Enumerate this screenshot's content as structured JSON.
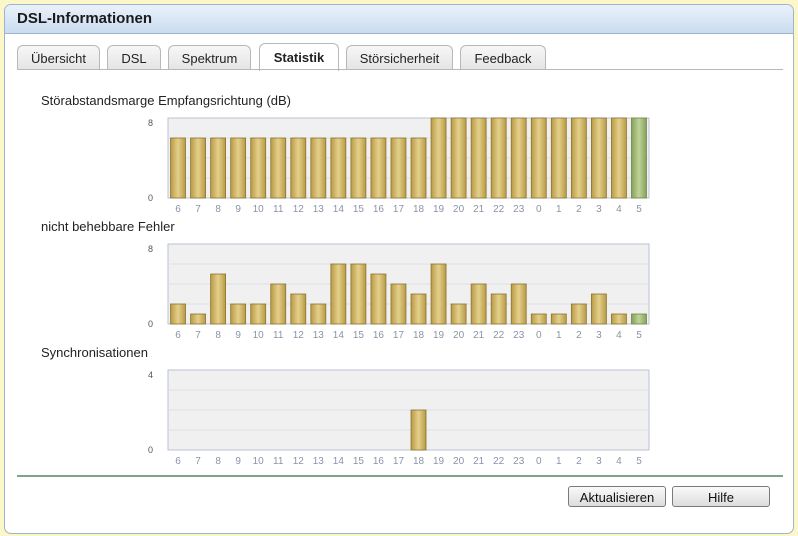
{
  "window": {
    "title": "DSL-Informationen"
  },
  "tabs": [
    {
      "label": "Übersicht",
      "active": false
    },
    {
      "label": "DSL",
      "active": false
    },
    {
      "label": "Spektrum",
      "active": false
    },
    {
      "label": "Statistik",
      "active": true
    },
    {
      "label": "Störsicherheit",
      "active": false
    },
    {
      "label": "Feedback",
      "active": false
    }
  ],
  "charts": {
    "snr": {
      "label": "Störabstandsmarge Empfangsrichtung (dB)"
    },
    "errors": {
      "label": "nicht behebbare Fehler"
    },
    "sync": {
      "label": "Synchronisationen"
    }
  },
  "buttons": {
    "refresh_label": "Aktualisieren",
    "help_label": "Hilfe"
  },
  "colors": {
    "bar": "#c9b15f",
    "bar_current": "#9fb570",
    "separator": "#7fa38a"
  },
  "chart_data": [
    {
      "type": "bar",
      "title": "Störabstandsmarge Empfangsrichtung (dB)",
      "categories": [
        "6",
        "7",
        "8",
        "9",
        "10",
        "11",
        "12",
        "13",
        "14",
        "15",
        "16",
        "17",
        "18",
        "19",
        "20",
        "21",
        "22",
        "23",
        "0",
        "1",
        "2",
        "3",
        "4",
        "5"
      ],
      "values": [
        6,
        6,
        6,
        6,
        6,
        6,
        6,
        6,
        6,
        6,
        6,
        6,
        6,
        8,
        8,
        8,
        8,
        8,
        8,
        8,
        8,
        8,
        8,
        8
      ],
      "ylim": [
        0,
        8
      ],
      "yticks": [
        "0",
        "8"
      ],
      "grid": true
    },
    {
      "type": "bar",
      "title": "nicht behebbare Fehler",
      "categories": [
        "6",
        "7",
        "8",
        "9",
        "10",
        "11",
        "12",
        "13",
        "14",
        "15",
        "16",
        "17",
        "18",
        "19",
        "20",
        "21",
        "22",
        "23",
        "0",
        "1",
        "2",
        "3",
        "4",
        "5"
      ],
      "values": [
        2,
        1,
        5,
        2,
        2,
        4,
        3,
        2,
        6,
        6,
        5,
        4,
        3,
        6,
        2,
        4,
        3,
        4,
        1,
        1,
        2,
        3,
        1,
        1
      ],
      "ylim": [
        0,
        8
      ],
      "yticks": [
        "0",
        "8"
      ],
      "grid": true
    },
    {
      "type": "bar",
      "title": "Synchronisationen",
      "categories": [
        "6",
        "7",
        "8",
        "9",
        "10",
        "11",
        "12",
        "13",
        "14",
        "15",
        "16",
        "17",
        "18",
        "19",
        "20",
        "21",
        "22",
        "23",
        "0",
        "1",
        "2",
        "3",
        "4",
        "5"
      ],
      "values": [
        0,
        0,
        0,
        0,
        0,
        0,
        0,
        0,
        0,
        0,
        0,
        0,
        2,
        0,
        0,
        0,
        0,
        0,
        0,
        0,
        0,
        0,
        0,
        0
      ],
      "ylim": [
        0,
        4
      ],
      "yticks": [
        "0",
        "4"
      ],
      "grid": true
    }
  ]
}
